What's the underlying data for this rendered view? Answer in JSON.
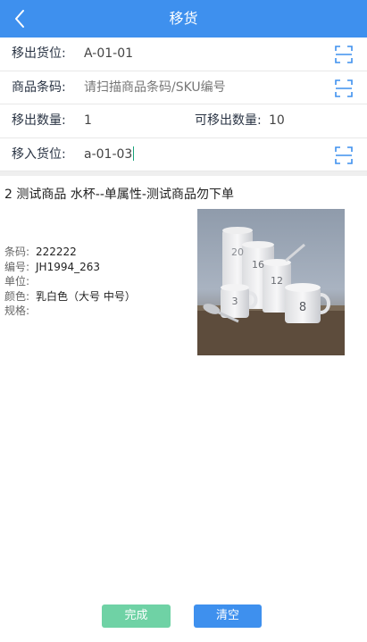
{
  "header": {
    "title": "移货"
  },
  "form": {
    "from_location": {
      "label": "移出货位:",
      "value": "A-01-01"
    },
    "barcode": {
      "label": "商品条码:",
      "placeholder": "请扫描商品条码/SKU编号"
    },
    "move_qty": {
      "label": "移出数量:",
      "value": "1"
    },
    "available_qty": {
      "label": "可移出数量:",
      "value": "10"
    },
    "to_location": {
      "label": "移入货位:",
      "value": "a-01-03"
    }
  },
  "product": {
    "name": "2 测试商品 水杯--单属性-测试商品勿下单",
    "attributes": [
      {
        "key": "条码:",
        "value": "222222"
      },
      {
        "key": "编号:",
        "value": "JH1994_263"
      },
      {
        "key": "单位:",
        "value": ""
      },
      {
        "key": "颜色:",
        "value": "乳白色（大号  中号）"
      },
      {
        "key": "规格:",
        "value": ""
      }
    ],
    "image_numbers": [
      "20",
      "16",
      "12",
      "3",
      "8"
    ]
  },
  "buttons": {
    "done": "完成",
    "clear": "清空"
  },
  "colors": {
    "primary": "#3e90ee",
    "done_button": "#6fd2a5"
  }
}
